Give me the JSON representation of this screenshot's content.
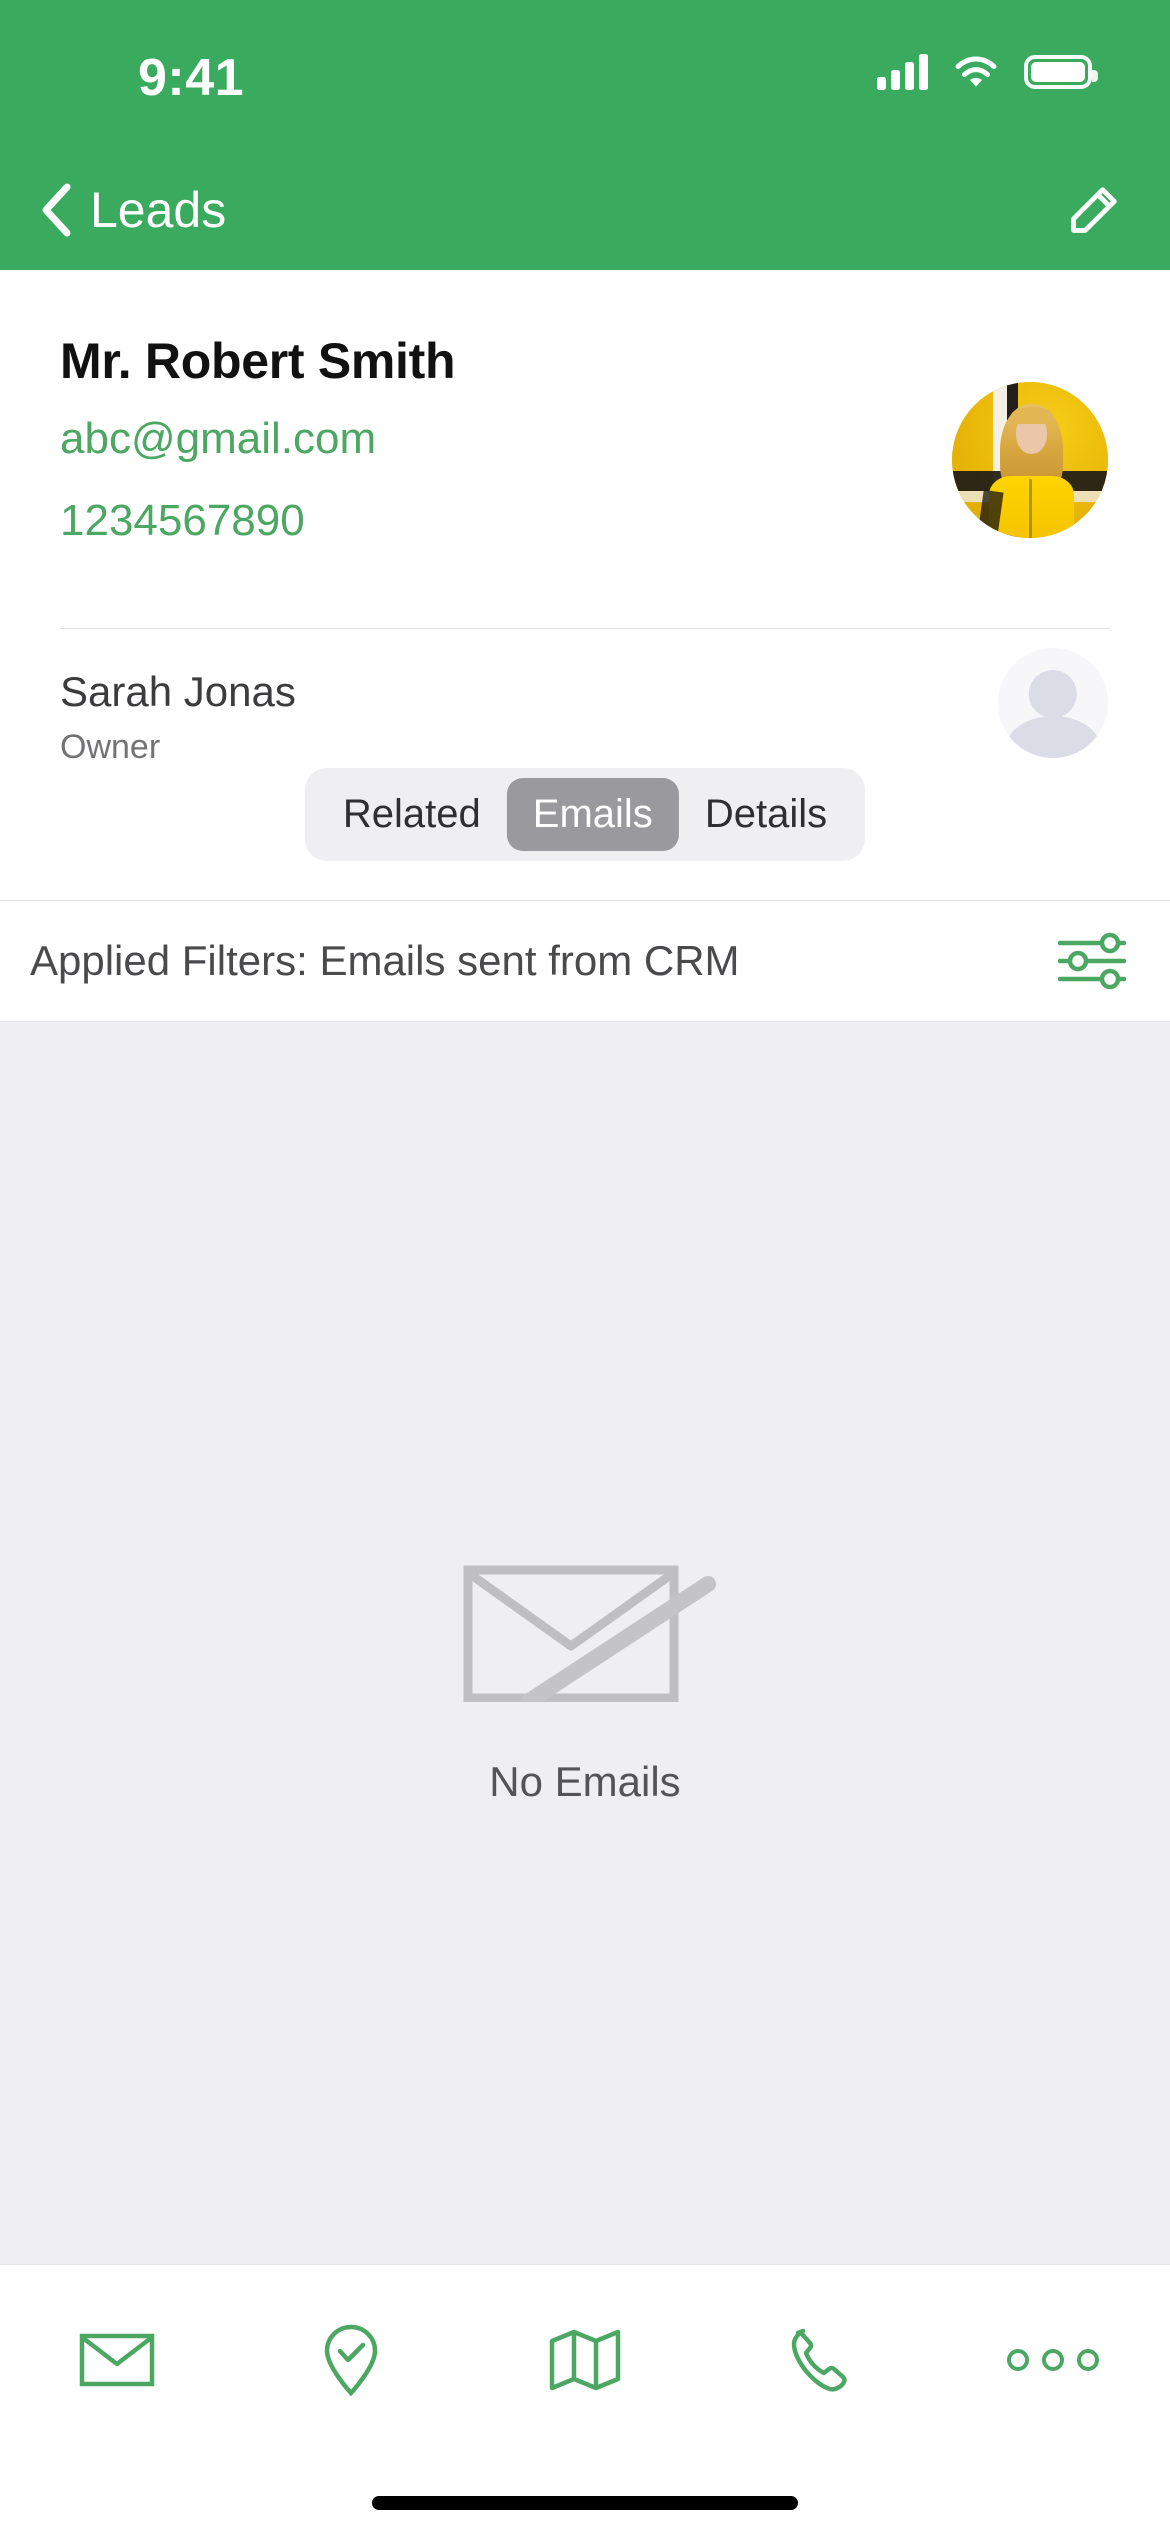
{
  "status_bar": {
    "time": "9:41",
    "signal_icon": "cellular-signal-icon",
    "wifi_icon": "wifi-icon",
    "battery_icon": "battery-full-icon"
  },
  "nav_bar": {
    "back_label": "Leads",
    "back_icon": "chevron-left-icon",
    "edit_icon": "pencil-edit-icon"
  },
  "contact": {
    "name": "Mr. Robert Smith",
    "email": "abc@gmail.com",
    "phone": "1234567890",
    "photo_alt": "contact-photo"
  },
  "owner": {
    "name": "Sarah Jonas",
    "role": "Owner",
    "avatar_alt": "default-person-avatar"
  },
  "tabs": {
    "items": [
      {
        "label": "Related",
        "active": false
      },
      {
        "label": "Emails",
        "active": true
      },
      {
        "label": "Details",
        "active": false
      }
    ]
  },
  "filter_bar": {
    "text": "Applied Filters: Emails sent from CRM",
    "filter_icon": "sliders-filter-icon"
  },
  "empty_state": {
    "icon": "no-email-slashed-envelope-icon",
    "label": "No Emails"
  },
  "toolbar": {
    "items": [
      {
        "name": "email",
        "icon": "envelope-icon"
      },
      {
        "name": "check-in",
        "icon": "location-pin-check-icon"
      },
      {
        "name": "map",
        "icon": "map-icon"
      },
      {
        "name": "call",
        "icon": "phone-handset-icon"
      },
      {
        "name": "more",
        "icon": "more-dots-icon"
      }
    ]
  },
  "colors": {
    "brand_green": "#3AAA5E",
    "link_green": "#4CA763",
    "icon_green": "#4CA763",
    "content_bg": "#EFEEF0",
    "segment_active_bg": "#9A9A9E"
  }
}
